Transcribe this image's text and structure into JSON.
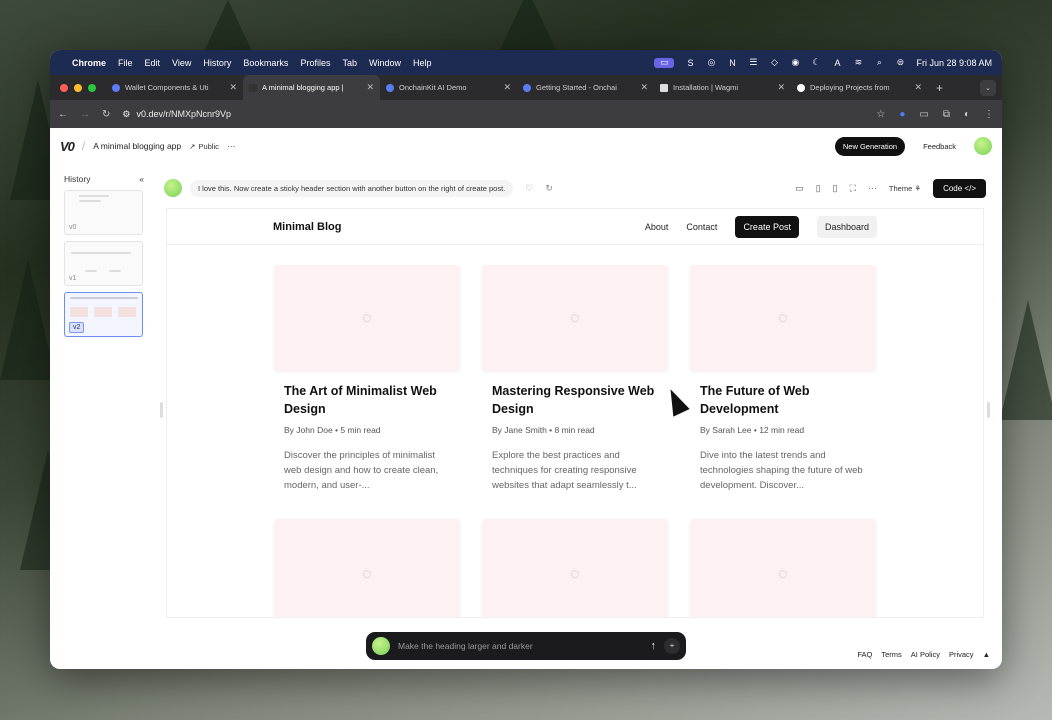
{
  "menubar": {
    "app": "Chrome",
    "items": [
      "File",
      "Edit",
      "View",
      "History",
      "Bookmarks",
      "Profiles",
      "Tab",
      "Window",
      "Help"
    ],
    "clock": "Fri Jun 28  9:08 AM"
  },
  "tabs": [
    {
      "title": "Wallet Components & Uti",
      "active": false
    },
    {
      "title": "A minimal blogging app |",
      "active": true
    },
    {
      "title": "OnchainKit AI Demo",
      "active": false
    },
    {
      "title": "Getting Started - Onchai",
      "active": false
    },
    {
      "title": "Installation | Wagmi",
      "active": false
    },
    {
      "title": "Deploying Projects from",
      "active": false
    }
  ],
  "address": {
    "url": "v0.dev/r/NMXpNcnr9Vp"
  },
  "app": {
    "logo": "V0",
    "project": "A minimal blogging app",
    "visibility": "Public",
    "more": "···",
    "new_generation": "New Generation",
    "feedback": "Feedback"
  },
  "history": {
    "title": "History",
    "collapse": "«",
    "versions": [
      "v0",
      "v1",
      "v2"
    ],
    "active_version": "v2"
  },
  "prompt": {
    "text": "I love this. Now create a sticky header section with another button on the right of create post.",
    "theme": "Theme",
    "code": "Code </>"
  },
  "blog": {
    "title": "Minimal Blog",
    "nav": [
      "About",
      "Contact",
      "Create Post",
      "Dashboard"
    ],
    "posts": [
      {
        "title": "The Art of Minimalist Web Design",
        "meta": "By John Doe • 5 min read",
        "excerpt": "Discover the principles of minimalist web design and how to create clean, modern, and user-..."
      },
      {
        "title": "Mastering Responsive Web Design",
        "meta": "By Jane Smith • 8 min read",
        "excerpt": "Explore the best practices and techniques for creating responsive websites that adapt seamlessly t..."
      },
      {
        "title": "The Future of Web Development",
        "meta": "By Sarah Lee • 12 min read",
        "excerpt": "Dive into the latest trends and technologies shaping the future of web development. Discover..."
      }
    ]
  },
  "chat": {
    "placeholder": "Make the heading larger and darker"
  },
  "footer": {
    "links": [
      "FAQ",
      "Terms",
      "AI Policy",
      "Privacy"
    ]
  }
}
